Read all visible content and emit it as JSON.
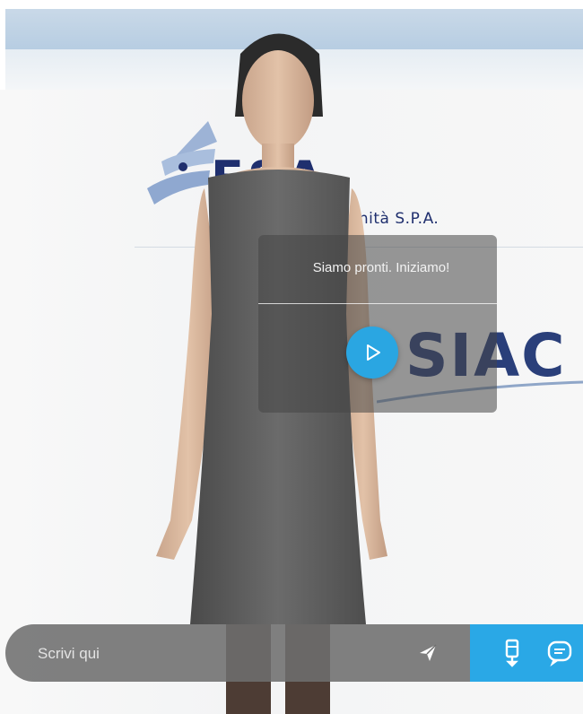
{
  "colors": {
    "accent": "#2aa8e6",
    "brand_navy": "#1f2f6e",
    "bubble": "#464646",
    "input_bar": "#6e6e6e"
  },
  "logo": {
    "wordmark": "ESA",
    "tagline": "per la Sanità S.P.A."
  },
  "product": {
    "name": "SIAC"
  },
  "speech": {
    "message": "Siamo pronti. Iniziamo!"
  },
  "icons": {
    "play": "play-icon",
    "send": "send-icon",
    "mic": "microphone-icon",
    "chat": "chat-icon"
  },
  "input": {
    "placeholder": "Scrivi qui",
    "value": ""
  }
}
